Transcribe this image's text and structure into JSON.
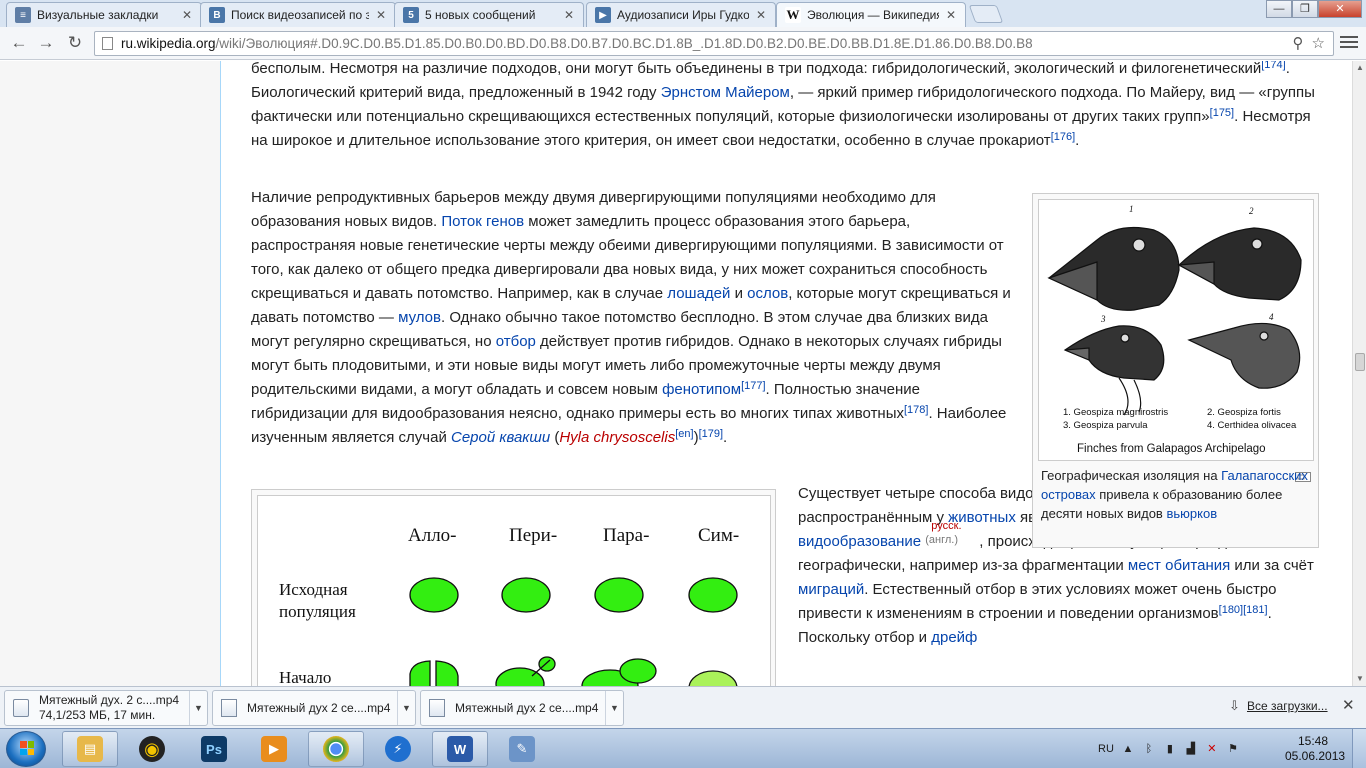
{
  "browser": {
    "tabs": [
      {
        "title": "Визуальные закладки",
        "icon_color": "#5f7ea6",
        "icon_glyph": "≡"
      },
      {
        "title": "Поиск видеозаписей по з",
        "icon_color": "#4a76a8",
        "icon_glyph": "В"
      },
      {
        "title": "5 новых сообщений",
        "icon_color": "#4a76a8",
        "icon_glyph": "5"
      },
      {
        "title": "Аудиозаписи Иры Гудко",
        "icon_color": "#4a76a8",
        "icon_glyph": "▶"
      },
      {
        "title": "Эволюция — Википедия",
        "icon_color": "#ffffff",
        "icon_glyph": "W"
      }
    ],
    "url_host": "ru.wikipedia.org",
    "url_path": "/wiki/Эволюция#.D0.9C.D0.B5.D1.85.D0.B0.D0.BD.D0.B8.D0.B7.D0.BC.D1.8B_.D1.8D.D0.B2.D0.BE.D0.BB.D1.8E.D1.86.D0.B8.D0.B8",
    "nav": {
      "back": "←",
      "forward": "→",
      "reload": "↻"
    },
    "window": {
      "minimize": "—",
      "maximize": "❐",
      "close": "✕"
    }
  },
  "article": {
    "p1": {
      "t1": "бесполым. Несмотря на различие подходов, они могут быть объединены в три подхода: гибридологический, экологический и филогенетический",
      "r1": "[174]",
      "t2": ". Биологический критерий вида, предложенный в 1942 году ",
      "l1": "Эрнстом Майером",
      "t3": ", — яркий пример гибридологического подхода. По Майеру, вид — «группы фактически или потенциально скрещивающихся естественных популяций, которые физиологически изолированы от других таких групп»",
      "r2": "[175]",
      "t4": ". Несмотря на широкое и длительное использование этого критерия, он имеет свои недостатки, особенно в случае прокариот",
      "r3": "[176]",
      "t5": "."
    },
    "p2": {
      "t1": "Наличие репродуктивных барьеров между двумя дивергирующими популяциями необходимо для образования новых видов. ",
      "l1": "Поток генов",
      "t2": " может замедлить процесс образования этого барьера, распространяя новые генетические черты между обеими дивергирующими популяциями. В зависимости от того, как далеко от общего предка дивергировали два новых вида, у них может сохраниться способность скрещиваться и давать потомство. Например, как в случае ",
      "l2": "лошадей",
      "t3": " и ",
      "l3": "ослов",
      "t4": ", которые могут скрещиваться и давать потомство — ",
      "l4": "мулов",
      "t5": ". Однако обычно такое потомство бесплодно. В этом случае два близких вида могут регулярно скрещиваться, но ",
      "l5": "отбор",
      "t6": " действует против гибридов. Однако в некоторых случаях гибриды могут быть плодовитыми, и эти новые виды могут иметь либо промежуточные черты между двумя родительскими видами, а могут обладать и совсем новым ",
      "l6": "фенотипом",
      "r1": "[177]",
      "t7": ". Полностью значение гибридизации для видообразования неясно, однако примеры есть во многих типах животных",
      "r2": "[178]",
      "t8": ". Наиболее изученным является случай ",
      "l7": "Серой квакши",
      "t9": " (",
      "l8": "Hyla chrysoscelis",
      "r3": "[en]",
      "t10": ")",
      "r4": "[179]",
      "t11": "."
    },
    "p3": {
      "t1": "Существует четыре способа видообразования. Наиболее распространённым у ",
      "l1": "животных",
      "t2": " является ",
      "l2": "аллопатрическое видообразование",
      "l3": "русск.",
      "note": "(англ.)",
      "t3": ", происходящее в популяциях, разделённых географически, например из-за фрагментации ",
      "l4": "мест обитания",
      "t4": " или за счёт ",
      "l5": "миграций",
      "t5": ". Естественный отбор в этих условиях может очень быстро привести к изменениям в строении и поведении организмов",
      "r1": "[180]",
      "r2": "[181]",
      "t6": ". Поскольку отбор и ",
      "l6": "дрейф"
    },
    "thumb": {
      "caption_t1": "Географическая изоляция на ",
      "caption_l1": "Галапагосских островах",
      "caption_t2": " привела к образованию более десяти новых видов ",
      "caption_l2": "вьюрков",
      "img_n1": "1",
      "img_n2": "2",
      "img_n3": "3",
      "img_n4": "4",
      "legend1": "1. Geospiza magnirostris",
      "legend2": "2. Geospiza fortis",
      "legend3": "3. Geospiza parvula",
      "legend4": "4. Certhidea olivacea",
      "img_title": "Finches from Galapagos Archipelago"
    },
    "diagram": {
      "columns": [
        "Алло-",
        "Пери-",
        "Пара-",
        "Сим-"
      ],
      "row1": "Исходная популяция",
      "row2": "Начало",
      "fill_color": "#33ee11"
    }
  },
  "downloads": {
    "items": [
      {
        "name": "Мятежный дух. 2 с....mp4",
        "status": "74,1/253 МБ, 17 мин."
      },
      {
        "name": "Мятежный дух 2 се....mp4"
      },
      {
        "name": "Мятежный дух 2 се....mp4"
      }
    ],
    "all_label": "Все загрузки...",
    "close": "✕"
  },
  "taskbar": {
    "apps": [
      {
        "name": "explorer",
        "glyph": "▤",
        "color": "#e7b84a"
      },
      {
        "name": "aimp",
        "glyph": "◉",
        "color": "#f2c400"
      },
      {
        "name": "photoshop",
        "glyph": "Ps",
        "color": "#0d3a66"
      },
      {
        "name": "media-player",
        "glyph": "▶",
        "color": "#e98d1d"
      },
      {
        "name": "chrome",
        "glyph": "◎",
        "color": "#2f9a42"
      },
      {
        "name": "flashget",
        "glyph": "⚡",
        "color": "#1f6fcf"
      },
      {
        "name": "word",
        "glyph": "W",
        "color": "#2b5aa8"
      },
      {
        "name": "paint",
        "glyph": "✎",
        "color": "#6c94c8"
      }
    ],
    "lang": "RU",
    "time": "15:48",
    "date": "05.06.2013"
  }
}
